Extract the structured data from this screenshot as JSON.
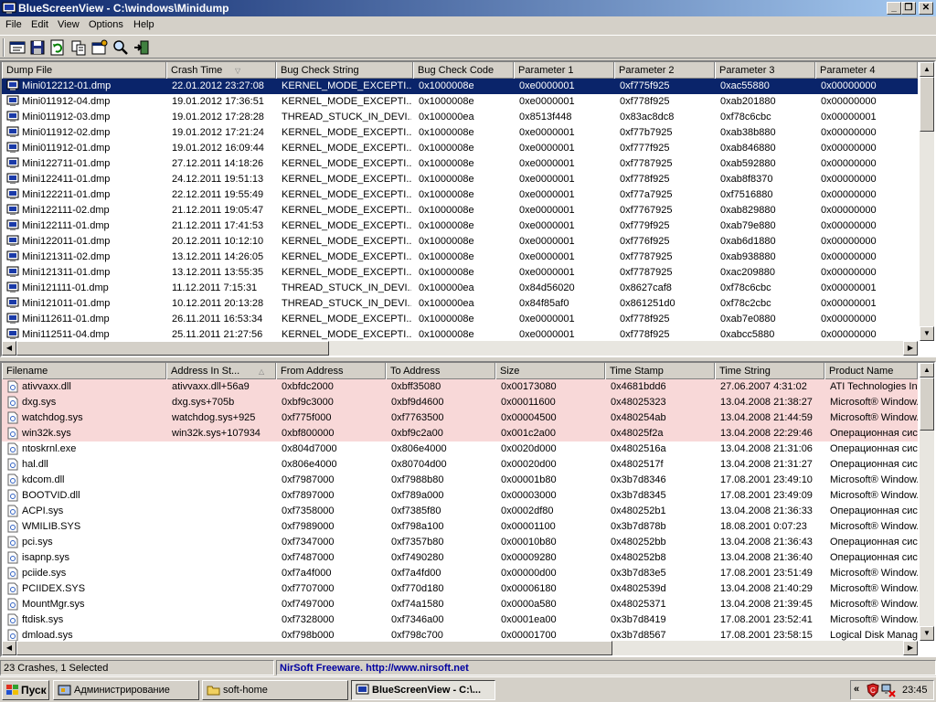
{
  "window": {
    "title": "BlueScreenView  -  C:\\windows\\Minidump",
    "minimize_label": "_",
    "restore_label": "❐",
    "close_label": "✕"
  },
  "menu": [
    "File",
    "Edit",
    "View",
    "Options",
    "Help"
  ],
  "toolbar": {
    "icons": [
      "properties-icon",
      "save-icon",
      "refresh-icon",
      "copy-icon",
      "html-report-icon",
      "find-icon",
      "exit-icon"
    ]
  },
  "crash_table": {
    "columns": [
      "Dump File",
      "Crash Time",
      "Bug Check String",
      "Bug Check Code",
      "Parameter 1",
      "Parameter 2",
      "Parameter 3",
      "Parameter 4"
    ],
    "sorted_column": "Crash Time",
    "sort_direction": "descending",
    "rows": [
      [
        "Mini012212-01.dmp",
        "22.01.2012 23:27:08",
        "KERNEL_MODE_EXCEPTI...",
        "0x1000008e",
        "0xe0000001",
        "0xf775f925",
        "0xac55880",
        "0x00000000"
      ],
      [
        "Mini011912-04.dmp",
        "19.01.2012 17:36:51",
        "KERNEL_MODE_EXCEPTI...",
        "0x1000008e",
        "0xe0000001",
        "0xf778f925",
        "0xab201880",
        "0x00000000"
      ],
      [
        "Mini011912-03.dmp",
        "19.01.2012 17:28:28",
        "THREAD_STUCK_IN_DEVI...",
        "0x100000ea",
        "0x8513f448",
        "0x83ac8dc8",
        "0xf78c6cbc",
        "0x00000001"
      ],
      [
        "Mini011912-02.dmp",
        "19.01.2012 17:21:24",
        "KERNEL_MODE_EXCEPTI...",
        "0x1000008e",
        "0xe0000001",
        "0xf77b7925",
        "0xab38b880",
        "0x00000000"
      ],
      [
        "Mini011912-01.dmp",
        "19.01.2012 16:09:44",
        "KERNEL_MODE_EXCEPTI...",
        "0x1000008e",
        "0xe0000001",
        "0xf777f925",
        "0xab846880",
        "0x00000000"
      ],
      [
        "Mini122711-01.dmp",
        "27.12.2011 14:18:26",
        "KERNEL_MODE_EXCEPTI...",
        "0x1000008e",
        "0xe0000001",
        "0xf7787925",
        "0xab592880",
        "0x00000000"
      ],
      [
        "Mini122411-01.dmp",
        "24.12.2011 19:51:13",
        "KERNEL_MODE_EXCEPTI...",
        "0x1000008e",
        "0xe0000001",
        "0xf778f925",
        "0xab8f8370",
        "0x00000000"
      ],
      [
        "Mini122211-01.dmp",
        "22.12.2011 19:55:49",
        "KERNEL_MODE_EXCEPTI...",
        "0x1000008e",
        "0xe0000001",
        "0xf77a7925",
        "0xf7516880",
        "0x00000000"
      ],
      [
        "Mini122111-02.dmp",
        "21.12.2011 19:05:47",
        "KERNEL_MODE_EXCEPTI...",
        "0x1000008e",
        "0xe0000001",
        "0xf7767925",
        "0xab829880",
        "0x00000000"
      ],
      [
        "Mini122111-01.dmp",
        "21.12.2011 17:41:53",
        "KERNEL_MODE_EXCEPTI...",
        "0x1000008e",
        "0xe0000001",
        "0xf779f925",
        "0xab79e880",
        "0x00000000"
      ],
      [
        "Mini122011-01.dmp",
        "20.12.2011 10:12:10",
        "KERNEL_MODE_EXCEPTI...",
        "0x1000008e",
        "0xe0000001",
        "0xf776f925",
        "0xab6d1880",
        "0x00000000"
      ],
      [
        "Mini121311-02.dmp",
        "13.12.2011 14:26:05",
        "KERNEL_MODE_EXCEPTI...",
        "0x1000008e",
        "0xe0000001",
        "0xf7787925",
        "0xab938880",
        "0x00000000"
      ],
      [
        "Mini121311-01.dmp",
        "13.12.2011 13:55:35",
        "KERNEL_MODE_EXCEPTI...",
        "0x1000008e",
        "0xe0000001",
        "0xf7787925",
        "0xac209880",
        "0x00000000"
      ],
      [
        "Mini121111-01.dmp",
        "11.12.2011 7:15:31",
        "THREAD_STUCK_IN_DEVI...",
        "0x100000ea",
        "0x84d56020",
        "0x8627caf8",
        "0xf78c6cbc",
        "0x00000001"
      ],
      [
        "Mini121011-01.dmp",
        "10.12.2011 20:13:28",
        "THREAD_STUCK_IN_DEVI...",
        "0x100000ea",
        "0x84f85af0",
        "0x861251d0",
        "0xf78c2cbc",
        "0x00000001"
      ],
      [
        "Mini112611-01.dmp",
        "26.11.2011 16:53:34",
        "KERNEL_MODE_EXCEPTI...",
        "0x1000008e",
        "0xe0000001",
        "0xf778f925",
        "0xab7e0880",
        "0x00000000"
      ],
      [
        "Mini112511-04.dmp",
        "25.11.2011 21:27:56",
        "KERNEL_MODE_EXCEPTI...",
        "0x1000008e",
        "0xe0000001",
        "0xf778f925",
        "0xabcc5880",
        "0x00000000"
      ]
    ]
  },
  "driver_table": {
    "columns": [
      "Filename",
      "Address In St...",
      "From Address",
      "To Address",
      "Size",
      "Time Stamp",
      "Time String",
      "Product Name"
    ],
    "sorted_column": "Address In St...",
    "rows": [
      [
        "ativvaxx.dll",
        "ativvaxx.dll+56a9",
        "0xbfdc2000",
        "0xbff35080",
        "0x00173080",
        "0x4681bdd6",
        "27.06.2007 4:31:02",
        "ATI Technologies In..."
      ],
      [
        "dxg.sys",
        "dxg.sys+705b",
        "0xbf9c3000",
        "0xbf9d4600",
        "0x00011600",
        "0x48025323",
        "13.04.2008 21:38:27",
        "Microsoft® Window..."
      ],
      [
        "watchdog.sys",
        "watchdog.sys+925",
        "0xf775f000",
        "0xf7763500",
        "0x00004500",
        "0x480254ab",
        "13.04.2008 21:44:59",
        "Microsoft® Window..."
      ],
      [
        "win32k.sys",
        "win32k.sys+107934",
        "0xbf800000",
        "0xbf9c2a00",
        "0x001c2a00",
        "0x48025f2a",
        "13.04.2008 22:29:46",
        "Операционная сис..."
      ],
      [
        "ntoskrnl.exe",
        "",
        "0x804d7000",
        "0x806e4000",
        "0x0020d000",
        "0x4802516a",
        "13.04.2008 21:31:06",
        "Операционная сис..."
      ],
      [
        "hal.dll",
        "",
        "0x806e4000",
        "0x80704d00",
        "0x00020d00",
        "0x4802517f",
        "13.04.2008 21:31:27",
        "Операционная сис..."
      ],
      [
        "kdcom.dll",
        "",
        "0xf7987000",
        "0xf7988b80",
        "0x00001b80",
        "0x3b7d8346",
        "17.08.2001 23:49:10",
        "Microsoft® Window..."
      ],
      [
        "BOOTVID.dll",
        "",
        "0xf7897000",
        "0xf789a000",
        "0x00003000",
        "0x3b7d8345",
        "17.08.2001 23:49:09",
        "Microsoft® Window..."
      ],
      [
        "ACPI.sys",
        "",
        "0xf7358000",
        "0xf7385f80",
        "0x0002df80",
        "0x480252b1",
        "13.04.2008 21:36:33",
        "Операционная сис..."
      ],
      [
        "WMILIB.SYS",
        "",
        "0xf7989000",
        "0xf798a100",
        "0x00001100",
        "0x3b7d878b",
        "18.08.2001 0:07:23",
        "Microsoft® Window..."
      ],
      [
        "pci.sys",
        "",
        "0xf7347000",
        "0xf7357b80",
        "0x00010b80",
        "0x480252bb",
        "13.04.2008 21:36:43",
        "Операционная сис..."
      ],
      [
        "isapnp.sys",
        "",
        "0xf7487000",
        "0xf7490280",
        "0x00009280",
        "0x480252b8",
        "13.04.2008 21:36:40",
        "Операционная сис..."
      ],
      [
        "pciide.sys",
        "",
        "0xf7a4f000",
        "0xf7a4fd00",
        "0x00000d00",
        "0x3b7d83e5",
        "17.08.2001 23:51:49",
        "Microsoft® Window..."
      ],
      [
        "PCIIDEX.SYS",
        "",
        "0xf7707000",
        "0xf770d180",
        "0x00006180",
        "0x4802539d",
        "13.04.2008 21:40:29",
        "Microsoft® Window..."
      ],
      [
        "MountMgr.sys",
        "",
        "0xf7497000",
        "0xf74a1580",
        "0x0000a580",
        "0x48025371",
        "13.04.2008 21:39:45",
        "Microsoft® Window..."
      ],
      [
        "ftdisk.sys",
        "",
        "0xf7328000",
        "0xf7346a00",
        "0x0001ea00",
        "0x3b7d8419",
        "17.08.2001 23:52:41",
        "Microsoft® Window..."
      ],
      [
        "dmload.sys",
        "",
        "0xf798b000",
        "0xf798c700",
        "0x00001700",
        "0x3b7d8567",
        "17.08.2001 23:58:15",
        "Logical Disk Manage..."
      ]
    ]
  },
  "status": {
    "count_text": "23 Crashes, 1 Selected",
    "credit_text": "NirSoft Freeware.  http://www.nirsoft.net"
  },
  "taskbar": {
    "start_label": "Пуск",
    "tasks": [
      "Администрирование",
      "soft-home",
      "BlueScreenView  -  C:\\..."
    ],
    "tray_chevron": "«",
    "clock": "23:45"
  },
  "colors": {
    "title_gradient_start": "#0a246a",
    "selection": "#0a246a",
    "highlight_row": "#f8d8d8",
    "credit_text": "#0000a0"
  }
}
